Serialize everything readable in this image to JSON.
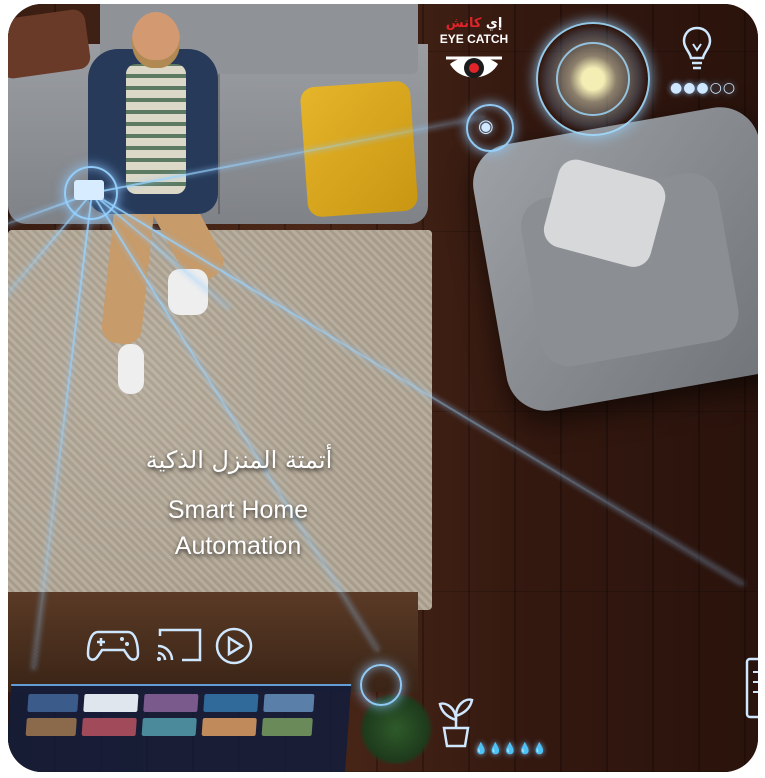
{
  "brand": {
    "name_ar_prefix": "إي",
    "name_ar_main": "كاتش",
    "name_en": "EYE CATCH"
  },
  "headline": {
    "ar": "أتمتة المنزل الذكية",
    "en_line1": "Smart Home",
    "en_line2": "Automation"
  },
  "indicators": {
    "lamp_dots": "●●●○○",
    "plant_drops": "💧💧💧💧💧"
  },
  "icons": [
    "lightbulb-icon",
    "gamepad-icon",
    "cast-icon",
    "play-icon",
    "plant-icon",
    "document-icon",
    "tablet-icon",
    "camera-icon"
  ],
  "colors": {
    "glow": "#8cc8ff",
    "logo_red": "#e0242a"
  }
}
